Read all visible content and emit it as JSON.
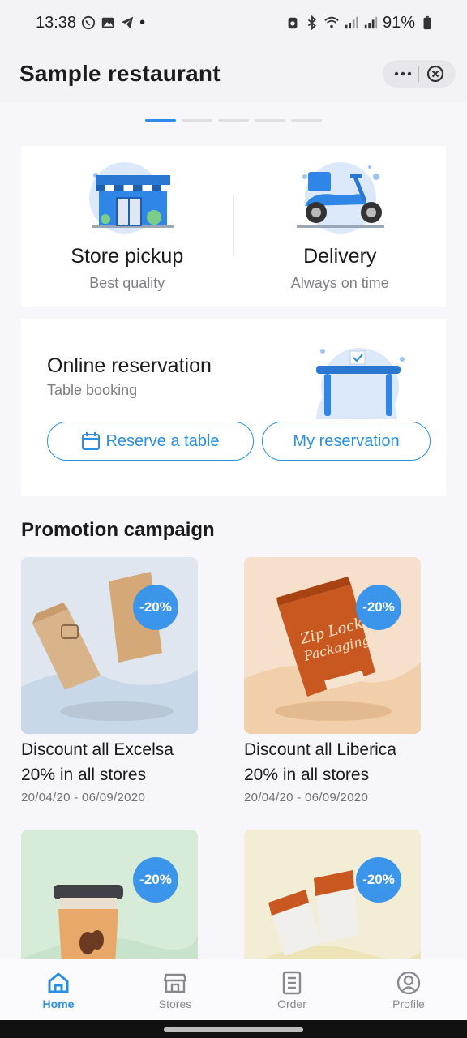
{
  "status_bar": {
    "time": "13:38",
    "dot": "•",
    "battery": "91%"
  },
  "header": {
    "title": "Sample restaurant",
    "more_icon": "more-horizontal-icon",
    "close_icon": "close-circle-icon"
  },
  "pager": {
    "count": 5,
    "active_index": 0
  },
  "services": [
    {
      "title": "Store pickup",
      "subtitle": "Best quality",
      "icon": "store-icon"
    },
    {
      "title": "Delivery",
      "subtitle": "Always on time",
      "icon": "scooter-icon"
    }
  ],
  "reservation": {
    "title": "Online reservation",
    "subtitle": "Table booking",
    "reserve_label": "Reserve a table",
    "my_reservation_label": "My reservation",
    "icon": "table-icon"
  },
  "promotion": {
    "title": "Promotion campaign",
    "items": [
      {
        "name": "Discount all Excelsa 20% in all stores",
        "date": "20/04/20 - 06/09/2020",
        "badge": "-20%",
        "bg": "#dfe6ef"
      },
      {
        "name": "Discount all Liberica 20% in all stores",
        "date": "20/04/20 - 06/09/2020",
        "badge": "-20%",
        "bg": "#f6e0cc"
      },
      {
        "name": "",
        "date": "",
        "badge": "-20%",
        "bg": "#d6ecd9"
      },
      {
        "name": "",
        "date": "",
        "badge": "-20%",
        "bg": "#f4edd6"
      }
    ]
  },
  "nav": [
    {
      "label": "Home",
      "icon": "home-icon",
      "active": true
    },
    {
      "label": "Stores",
      "icon": "store-icon",
      "active": false
    },
    {
      "label": "Order",
      "icon": "order-icon",
      "active": false
    },
    {
      "label": "Profile",
      "icon": "profile-icon",
      "active": false
    }
  ],
  "colors": {
    "accent": "#2a8fe0",
    "badge": "#3b95ea"
  }
}
